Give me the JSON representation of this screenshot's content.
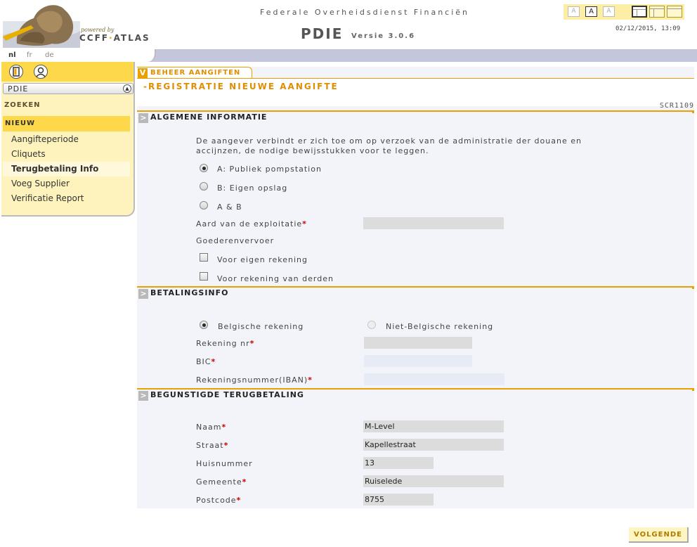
{
  "header": {
    "powered_by": "powered by",
    "brand_main": "CCFF",
    "brand_dot": "·",
    "brand_rest": "ATLAS",
    "agency": "Federale Overheidsdienst Financiën",
    "app_title": "PDIE",
    "app_version": "Versie 3.0.6",
    "datetime": "02/12/2015, 13:09",
    "font_sizes": [
      "A",
      "A",
      "A"
    ],
    "logo_icon": "sculpture-logo-icon"
  },
  "languages": [
    "nl",
    "fr",
    "de"
  ],
  "active_language": "nl",
  "sidebar": {
    "icons": [
      "door-icon",
      "user-icon"
    ],
    "title": "PDIE",
    "collapse_icon": "chevron-up-icon",
    "zoeken": "ZOEKEN",
    "nieuw": "NIEUW",
    "items": [
      {
        "label": "Aangifteperiode"
      },
      {
        "label": "Cliquets"
      },
      {
        "label": "Terugbetaling Info"
      },
      {
        "label": "Voeg Supplier"
      },
      {
        "label": "Verificatie Report"
      }
    ],
    "active_item": "Terugbetaling Info"
  },
  "main": {
    "breadcrumb": "BEHEER AANGIFTEN",
    "page_title": "-REGISTRATIE NIEUWE AANGIFTE",
    "screen_id": "SCR1109",
    "section1": {
      "title": "ALGEMENE INFORMATIE",
      "intro_line1": "De aangever verbindt er zich toe om op verzoek van de administratie der douane en",
      "intro_line2": "accijnzen, de nodige bewijsstukken voor te leggen.",
      "options": [
        {
          "label": "A: Publiek pompstation",
          "checked": true
        },
        {
          "label": "B: Eigen opslag",
          "checked": false
        },
        {
          "label": "A & B",
          "checked": false
        }
      ],
      "aard_label": "Aard van de exploitatie",
      "aard_value": "",
      "goederen_label": "Goederenvervoer",
      "checkboxes": [
        {
          "label": "Voor eigen rekening",
          "checked": false
        },
        {
          "label": "Voor rekening van derden",
          "checked": false
        }
      ]
    },
    "section2": {
      "title": "BETALINGSINFO",
      "radio_belgisch": "Belgische rekening",
      "radio_niet_belgisch": "Niet-Belgische rekening",
      "rekening_label": "Rekening nr",
      "rekening_value": "",
      "bic_label": "BIC",
      "bic_value": "",
      "iban_label": "Rekeningsnummer(IBAN)",
      "iban_value": ""
    },
    "section3": {
      "title": "BEGUNSTIGDE TERUGBETALING",
      "naam_label": "Naam",
      "naam_value": "M-Level",
      "straat_label": "Straat",
      "straat_value": "Kapellestraat",
      "huisnummer_label": "Huisnummer",
      "huisnummer_value": "13",
      "gemeente_label": "Gemeente",
      "gemeente_value": "Ruiselede",
      "postcode_label": "Postcode",
      "postcode_value": "8755"
    },
    "required_marker": "*"
  },
  "footer": {
    "next_button": "VOLGENDE"
  },
  "colors": {
    "accent": "#e8a100",
    "sidebar_bg": "#fff3bd",
    "sidebar_active": "#fcd84a",
    "lang_bar": "#c4c6dc",
    "content_bg": "#f2f4f9"
  }
}
